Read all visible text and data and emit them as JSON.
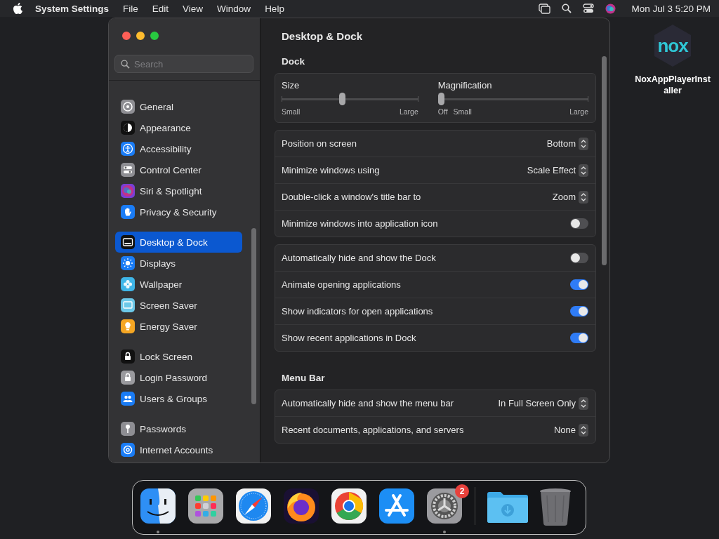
{
  "menu_bar": {
    "app_name": "System Settings",
    "menus": [
      "File",
      "Edit",
      "View",
      "Window",
      "Help"
    ],
    "clock": "Mon Jul 3  5:20 PM"
  },
  "window": {
    "title": "Desktop & Dock"
  },
  "sidebar": {
    "search": {
      "placeholder": "Search"
    },
    "groups": [
      {
        "items": [
          {
            "label": "General",
            "selected": false
          },
          {
            "label": "Appearance",
            "selected": false
          },
          {
            "label": "Accessibility",
            "selected": false
          },
          {
            "label": "Control Center",
            "selected": false
          },
          {
            "label": "Siri & Spotlight",
            "selected": false
          },
          {
            "label": "Privacy & Security",
            "selected": false
          }
        ]
      },
      {
        "items": [
          {
            "label": "Desktop & Dock",
            "selected": true
          },
          {
            "label": "Displays",
            "selected": false
          },
          {
            "label": "Wallpaper",
            "selected": false
          },
          {
            "label": "Screen Saver",
            "selected": false
          },
          {
            "label": "Energy Saver",
            "selected": false
          }
        ]
      },
      {
        "items": [
          {
            "label": "Lock Screen",
            "selected": false
          },
          {
            "label": "Login Password",
            "selected": false
          },
          {
            "label": "Users & Groups",
            "selected": false
          }
        ]
      },
      {
        "items": [
          {
            "label": "Passwords",
            "selected": false
          },
          {
            "label": "Internet Accounts",
            "selected": false
          }
        ]
      }
    ]
  },
  "sections": [
    {
      "heading": "Dock",
      "cards": [
        {
          "kind": "sliders",
          "sliders": [
            {
              "label": "Size",
              "level": 0.44,
              "scale": [
                "Small",
                "Large"
              ]
            },
            {
              "label": "Magnification",
              "level": 0,
              "scale": [
                "Off",
                "Small",
                "Large"
              ]
            }
          ]
        },
        {
          "kind": "rows",
          "rows": [
            {
              "kind": "popup",
              "label": "Position on screen",
              "value": "Bottom"
            },
            {
              "kind": "popup",
              "label": "Minimize windows using",
              "value": "Scale Effect"
            },
            {
              "kind": "popup",
              "label": "Double-click a window's title bar to",
              "value": "Zoom"
            },
            {
              "kind": "toggle",
              "label": "Minimize windows into application icon",
              "on": false
            }
          ]
        },
        {
          "kind": "rows",
          "rows": [
            {
              "kind": "toggle",
              "label": "Automatically hide and show the Dock",
              "on": false
            },
            {
              "kind": "toggle",
              "label": "Animate opening applications",
              "on": true
            },
            {
              "kind": "toggle",
              "label": "Show indicators for open applications",
              "on": true
            },
            {
              "kind": "toggle",
              "label": "Show recent applications in Dock",
              "on": true
            }
          ]
        }
      ]
    },
    {
      "heading": "Menu Bar",
      "cards": [
        {
          "kind": "rows",
          "rows": [
            {
              "kind": "popup",
              "label": "Automatically hide and show the menu bar",
              "value": "In Full Screen Only"
            },
            {
              "kind": "popup",
              "label": "Recent documents, applications, and servers",
              "value": "None"
            }
          ]
        }
      ]
    }
  ],
  "desktop_icon": {
    "logo": "nox",
    "label": "NoxAppPlayerInstaller"
  },
  "dock": {
    "apps": [
      {
        "running": true
      },
      {
        "running": false
      },
      {
        "running": false
      },
      {
        "running": false
      },
      {
        "running": false
      },
      {
        "running": false
      },
      {
        "running": true,
        "badge": "2"
      }
    ]
  }
}
